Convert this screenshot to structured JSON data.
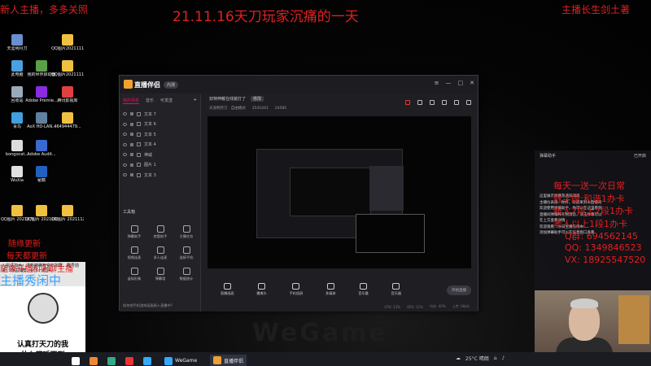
{
  "overlay": {
    "top_title": "21.11.16天刀玩家沉痛的一天",
    "top_left": "新人主播，多多关照",
    "top_right": "主播长生剑土著",
    "left_mid_1": "随缘更新",
    "left_mid_2": "每天都更新",
    "left_mid_3": "随缘开播和闲聊主播",
    "left_big": "主播秀闲中",
    "right_lines": [
      "每天一送一次日常",
      "数字段:和谐1办卡",
      "新人2段上2段1办卡",
      "老人以上1段1办卡",
      "Q群: 694562145",
      "QQ: 1349846523",
      "VX: 18925547520"
    ]
  },
  "desktop_icons": [
    {
      "label": "天涯明月刀",
      "color": "#6a8fd0"
    },
    {
      "label": "QQ图片2021111...",
      "color": "#f0c040"
    },
    {
      "label": "此电脑",
      "color": "#4aa0e0"
    },
    {
      "label": "我的世界启动器",
      "color": "#5aa04a"
    },
    {
      "label": "QQ图片2021111...",
      "color": "#f0c040"
    },
    {
      "label": "回收站",
      "color": "#9ab"
    },
    {
      "label": "Adobe Premie...",
      "color": "#8a2be2"
    },
    {
      "label": "腾讯影视库",
      "color": "#e04040"
    },
    {
      "label": "青鸟",
      "color": "#40a0e0"
    },
    {
      "label": "AoX HD-LAN...",
      "color": "#6080a0"
    },
    {
      "label": "464944479...",
      "color": "#f0c040"
    },
    {
      "label": "bongocat...",
      "color": "#ddd"
    },
    {
      "label": "Adobe Audit...",
      "color": "#3a6ad0"
    },
    {
      "label": "WuXia",
      "color": "#e0e0e0"
    },
    {
      "label": "秘籍",
      "color": "#2060c0"
    },
    {
      "label": "QQ图片 2021070...",
      "color": "#f0c040"
    },
    {
      "label": "QQ图片 2021100...",
      "color": "#f0c040"
    },
    {
      "label": "QQ图片 2021112...",
      "color": "#f0c040"
    }
  ],
  "app": {
    "name": "直播伴侣",
    "version": "内测",
    "side_tabs": [
      "我的场景",
      "音乐",
      "可发送"
    ],
    "sources": [
      "文本 7",
      "文本 6",
      "文本 5",
      "文本 4",
      "神威",
      "图片 1",
      "文本 3"
    ],
    "tools_title": "工具箱",
    "tools": [
      "弹幕助手",
      "房管助手",
      "主播任务",
      "视频连麦",
      "多人连麦",
      "连接手机",
      "虚拟形象",
      "弹幕墙",
      "数据统计"
    ],
    "side_footer": "如何把手机游戏画面接入直播中?",
    "top_label": "双特伸戴在线装打了",
    "top_btn": "修改",
    "info": [
      "天涯明月刀 · 自由模式",
      "3541041",
      "24585"
    ],
    "bottom_tools": [
      "直播画面",
      "摄像头",
      "手机投屏",
      "多媒体",
      "音乐量",
      "音乐器"
    ],
    "live_btn": "开始直播",
    "status": [
      "CPU: 23%",
      "GPU: 11%",
      "内存: 40%",
      "上传: 0kb/s"
    ]
  },
  "chat": {
    "title": "弹幕助手",
    "count": "已开启",
    "lines": [
      "这里展示弹幕及通知消息",
      "主播仪表盘...你好，欢迎来到本直播间",
      "欢迎使用弹幕助手，你可以在这里看到",
      "直播间弹幕和礼物消息，双击弹幕可以",
      "在上方查看详情",
      "欢迎观看：今日主播在线中",
      "添加弹幕助手可以在任意窗口查看"
    ]
  },
  "meme": {
    "top": "认真打天刀的我",
    "bottom": "什么都听不到"
  },
  "promo": "入宗请加大：送新装稀有宝石加群，群号前进，前往加群，看了一起冲。",
  "taskbar": {
    "apps": [
      {
        "label": "WeGame",
        "active": false
      },
      {
        "label": "直播伴侣",
        "active": true
      }
    ],
    "temp": "25°C 晴朗",
    "time": "",
    "icon_colors": [
      "#fff",
      "#e83",
      "#3a8",
      "#e33",
      "#3af"
    ]
  }
}
